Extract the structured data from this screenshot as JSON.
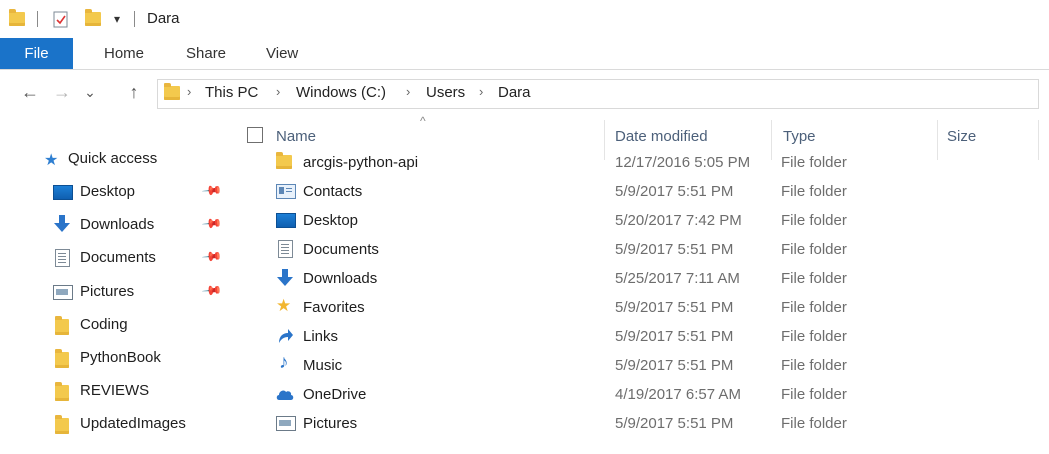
{
  "window": {
    "title": "Dara",
    "qa_dropdown": "▾"
  },
  "ribbon": {
    "tabs": [
      "File",
      "Home",
      "Share",
      "View"
    ]
  },
  "nav": {
    "back": "←",
    "forward": "→",
    "recent": "⌄",
    "up": "↑"
  },
  "address": {
    "crumbs": [
      "This PC",
      "Windows (C:)",
      "Users",
      "Dara"
    ],
    "separator": "›"
  },
  "navpane": {
    "quick_access": "Quick access",
    "items": [
      {
        "label": "Desktop",
        "icon": "desktop-icon",
        "pinned": true
      },
      {
        "label": "Downloads",
        "icon": "downloads-icon",
        "pinned": true
      },
      {
        "label": "Documents",
        "icon": "documents-icon",
        "pinned": true
      },
      {
        "label": "Pictures",
        "icon": "pictures-icon",
        "pinned": true
      },
      {
        "label": "Coding",
        "icon": "folder-icon",
        "pinned": false
      },
      {
        "label": "PythonBook",
        "icon": "folder-icon",
        "pinned": false
      },
      {
        "label": "REVIEWS",
        "icon": "folder-icon",
        "pinned": false
      },
      {
        "label": "UpdatedImages",
        "icon": "folder-icon",
        "pinned": false
      }
    ]
  },
  "filelist": {
    "columns": {
      "name": "Name",
      "date": "Date modified",
      "type": "Type",
      "size": "Size"
    },
    "rows": [
      {
        "name": "arcgis-python-api",
        "date": "12/17/2016 5:05 PM",
        "type": "File folder",
        "icon": "folder-icon"
      },
      {
        "name": "Contacts",
        "date": "5/9/2017 5:51 PM",
        "type": "File folder",
        "icon": "contacts-icon"
      },
      {
        "name": "Desktop",
        "date": "5/20/2017 7:42 PM",
        "type": "File folder",
        "icon": "desktop-icon"
      },
      {
        "name": "Documents",
        "date": "5/9/2017 5:51 PM",
        "type": "File folder",
        "icon": "documents-icon"
      },
      {
        "name": "Downloads",
        "date": "5/25/2017 7:11 AM",
        "type": "File folder",
        "icon": "downloads-icon"
      },
      {
        "name": "Favorites",
        "date": "5/9/2017 5:51 PM",
        "type": "File folder",
        "icon": "favorites-star-icon"
      },
      {
        "name": "Links",
        "date": "5/9/2017 5:51 PM",
        "type": "File folder",
        "icon": "links-icon"
      },
      {
        "name": "Music",
        "date": "5/9/2017 5:51 PM",
        "type": "File folder",
        "icon": "music-note-icon"
      },
      {
        "name": "OneDrive",
        "date": "4/19/2017 6:57 AM",
        "type": "File folder",
        "icon": "onedrive-cloud-icon"
      },
      {
        "name": "Pictures",
        "date": "5/9/2017 5:51 PM",
        "type": "File folder",
        "icon": "pictures-icon"
      }
    ]
  },
  "colors": {
    "accent": "#1a73c9",
    "folder": "#f3c94d",
    "header_text": "#4c607a",
    "detail_text": "#6d6d6d"
  }
}
